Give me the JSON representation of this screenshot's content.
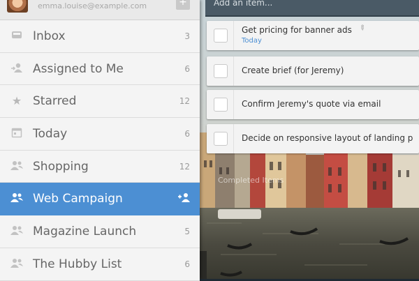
{
  "account": {
    "email": "emma.louise@example.com",
    "add_label": "+"
  },
  "sidebar": {
    "items": [
      {
        "label": "Inbox",
        "count": "3",
        "icon": "inbox-icon"
      },
      {
        "label": "Assigned to Me",
        "count": "6",
        "icon": "person-icon"
      },
      {
        "label": "Starred",
        "count": "12",
        "icon": "star-icon"
      },
      {
        "label": "Today",
        "count": "6",
        "icon": "calendar-icon"
      },
      {
        "label": "Shopping",
        "count": "12",
        "icon": "people-icon"
      },
      {
        "label": "Web Campaign",
        "count": "",
        "icon": "people-icon",
        "active": true
      },
      {
        "label": "Magazine Launch",
        "count": "5",
        "icon": "people-icon"
      },
      {
        "label": "The Hubby List",
        "count": "6",
        "icon": "people-icon"
      }
    ]
  },
  "main": {
    "add_placeholder": "Add an item...",
    "tasks": [
      {
        "title": "Get pricing for banner ads",
        "due": "Today"
      },
      {
        "title": "Create brief (for Jeremy)"
      },
      {
        "title": "Confirm Jeremy's quote via email"
      },
      {
        "title": "Decide on responsive layout of landing p"
      }
    ],
    "completed_label": "Completed Items"
  },
  "colors": {
    "accent": "#4c8fd3",
    "sidebar_bg": "#f4f4f4",
    "add_bar": "#4a5a66"
  }
}
